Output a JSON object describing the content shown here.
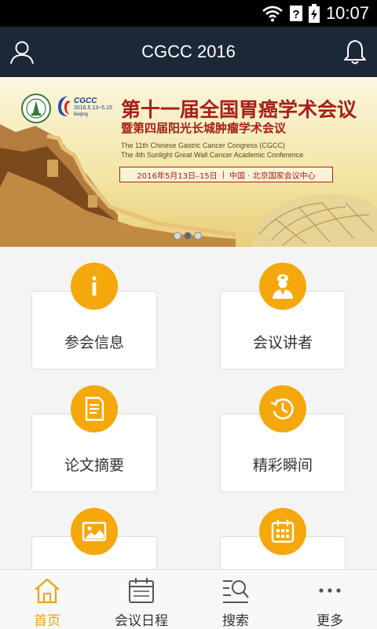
{
  "status_bar": {
    "time": "10:07",
    "icons": [
      "wifi-icon",
      "signal-unknown-icon",
      "battery-charging-icon"
    ]
  },
  "app_bar": {
    "title": "CGCC 2016",
    "left_icon": "user-icon",
    "right_icon": "bell-icon"
  },
  "banner": {
    "logo_cgcc": "CGCC",
    "logo_dates": "2016.5.13~5.15",
    "logo_city": "Beijing",
    "title_cn": "第十一届全国胃癌学术会议",
    "subtitle_cn": "暨第四届阳光长城肿瘤学术会议",
    "title_en_1": "The 11th Chinese Gastric Cancer Congress (CGCC)",
    "title_en_2": "The 4th Sunlight Great Wall Cancer Academic Conference",
    "date_text": "2016年5月13日–15日",
    "separator": "|",
    "venue_text": "中国 · 北京国家会议中心",
    "carousel": {
      "count": 3,
      "active": 1
    }
  },
  "menu": {
    "items": [
      {
        "label": "参会信息",
        "icon": "info-icon"
      },
      {
        "label": "会议讲者",
        "icon": "speaker-person-icon"
      },
      {
        "label": "论文摘要",
        "icon": "document-icon"
      },
      {
        "label": "精彩瞬间",
        "icon": "history-clock-icon"
      },
      {
        "label": "",
        "icon": "image-gallery-icon"
      },
      {
        "label": "",
        "icon": "calendar-grid-icon"
      }
    ]
  },
  "tab_bar": {
    "tabs": [
      {
        "label": "首页",
        "icon": "home-icon",
        "active": true
      },
      {
        "label": "会议日程",
        "icon": "calendar-icon",
        "active": false
      },
      {
        "label": "搜索",
        "icon": "search-list-icon",
        "active": false
      },
      {
        "label": "更多",
        "icon": "more-dots-icon",
        "active": false
      }
    ]
  },
  "colors": {
    "app_bar": "#1c2838",
    "accent": "#f5a80c",
    "tab_active": "#f0a30a",
    "banner_title": "#a8201a"
  }
}
